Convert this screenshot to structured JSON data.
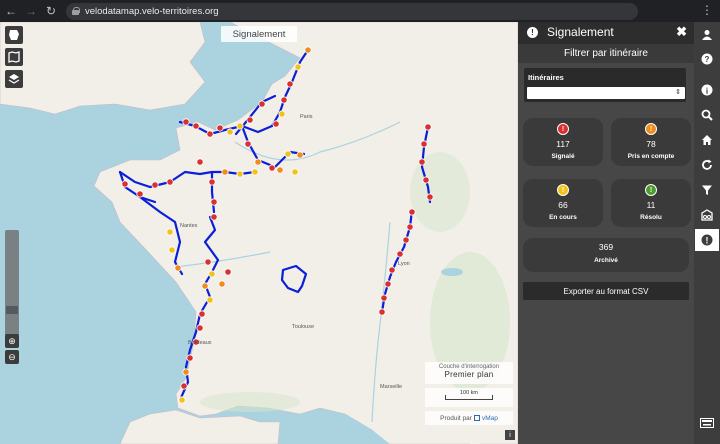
{
  "browser": {
    "url": "velodatamap.velo-territoires.org",
    "back_icon": "back-arrow-icon",
    "forward_icon": "forward-arrow-icon",
    "reload_icon": "reload-icon",
    "menu_icon": "kebab-menu-icon"
  },
  "map": {
    "title": "Signalement",
    "layer_label": "Couche d'interrogation",
    "layer_value": "Premier plan",
    "scale": "100 km",
    "credit_prefix": "Produit par",
    "credit_brand": "vMap",
    "info_glyph": "i"
  },
  "panel": {
    "title": "Signalement",
    "subtitle": "Filtrer par itinéraire",
    "itineraries_label": "Itinéraires",
    "itineraries_value": "",
    "stats": [
      {
        "value": "117",
        "label": "Signalé",
        "color": "#d93131",
        "glyph": "!"
      },
      {
        "value": "78",
        "label": "Pris en compte",
        "color": "#f08c1e",
        "glyph": "!"
      },
      {
        "value": "66",
        "label": "En cours",
        "color": "#f2c21b",
        "glyph": "!"
      },
      {
        "value": "11",
        "label": "Résolu",
        "color": "#4e9c2d",
        "glyph": "!"
      }
    ],
    "archived": {
      "value": "369",
      "label": "Archivé"
    },
    "export_label": "Exporter au format CSV"
  },
  "colors": {
    "route": "#0b1fd6",
    "marker_red": "#d93131",
    "marker_orange": "#f08c1e",
    "marker_yellow": "#f2c21b",
    "marker_green": "#4e9c2d",
    "sea": "#aad3df",
    "land": "#f2efe9"
  },
  "toolbar": [
    "user-icon",
    "help-icon",
    "info-icon",
    "search-icon",
    "home-icon",
    "refresh-icon",
    "filter-icon",
    "bike-route-icon",
    "alert-icon",
    "keyboard-icon"
  ]
}
